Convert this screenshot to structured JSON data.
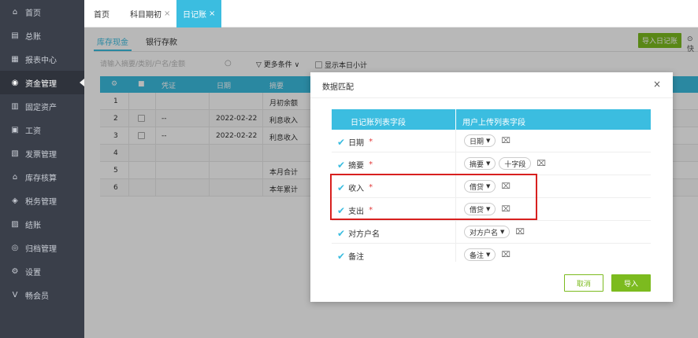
{
  "sidebar": {
    "items": [
      {
        "label": "首页",
        "icon": "home-icon",
        "glyph": "⌂"
      },
      {
        "label": "总账",
        "icon": "ledger-icon",
        "glyph": "▤"
      },
      {
        "label": "报表中心",
        "icon": "chart-icon",
        "glyph": "▦"
      },
      {
        "label": "资金管理",
        "icon": "fund-icon",
        "glyph": "◉"
      },
      {
        "label": "固定资产",
        "icon": "asset-icon",
        "glyph": "▥"
      },
      {
        "label": "工资",
        "icon": "salary-icon",
        "glyph": "▣"
      },
      {
        "label": "发票管理",
        "icon": "invoice-icon",
        "glyph": "▧"
      },
      {
        "label": "库存核算",
        "icon": "inventory-icon",
        "glyph": "⌂"
      },
      {
        "label": "税务管理",
        "icon": "tax-icon",
        "glyph": "◈"
      },
      {
        "label": "结账",
        "icon": "close-books-icon",
        "glyph": "▨"
      },
      {
        "label": "归档管理",
        "icon": "archive-icon",
        "glyph": "◎"
      },
      {
        "label": "设置",
        "icon": "settings-icon",
        "glyph": "⚙"
      },
      {
        "label": "畅会员",
        "icon": "vip-icon",
        "glyph": "V"
      }
    ],
    "active_index": 3
  },
  "tabs": [
    {
      "label": "首页",
      "closable": false
    },
    {
      "label": "科目期初",
      "closable": true
    },
    {
      "label": "日记账",
      "closable": true,
      "active": true
    }
  ],
  "subtabs": [
    {
      "label": "库存现金",
      "active": true
    },
    {
      "label": "银行存款",
      "active": false
    }
  ],
  "toolbar": {
    "import_label": "导入日记账",
    "gear_partial": "⊙ 快"
  },
  "filter": {
    "search_placeholder": "请输入摘要/类别/户名/金额",
    "more_conditions": "▽ 更多条件 ∨",
    "show_daily_subtotal": "显示本日小计"
  },
  "grid": {
    "headers": [
      "⚙",
      "■",
      "凭证",
      "日期",
      "摘要"
    ],
    "rows": [
      {
        "num": "1",
        "voucher": "",
        "date": "",
        "summary": "月初余额",
        "checkbox": false
      },
      {
        "num": "2",
        "voucher": "--",
        "date": "2022-02-22",
        "summary": "利息收入",
        "checkbox": true
      },
      {
        "num": "3",
        "voucher": "--",
        "date": "2022-02-22",
        "summary": "利息收入",
        "checkbox": true
      },
      {
        "num": "4",
        "voucher": "",
        "date": "",
        "summary": "",
        "checkbox": false
      },
      {
        "num": "5",
        "voucher": "",
        "date": "",
        "summary": "本月合计",
        "checkbox": false
      },
      {
        "num": "6",
        "voucher": "",
        "date": "",
        "summary": "本年累计",
        "checkbox": false
      }
    ]
  },
  "dialog": {
    "title": "数据匹配",
    "close_glyph": "×",
    "col_left": "日记账列表字段",
    "col_right": "用户上传列表字段",
    "rows": [
      {
        "field": "日期",
        "required": true,
        "selects": [
          "日期"
        ],
        "extra": ""
      },
      {
        "field": "摘要",
        "required": true,
        "selects": [
          "摘要"
        ],
        "extra": "十字段"
      },
      {
        "field": "收入",
        "required": true,
        "selects": [
          "借贷"
        ],
        "extra": ""
      },
      {
        "field": "支出",
        "required": true,
        "selects": [
          "借贷"
        ],
        "extra": ""
      },
      {
        "field": "对方户名",
        "required": false,
        "selects": [
          "对方户名"
        ],
        "extra": ""
      },
      {
        "field": "备注",
        "required": false,
        "selects": [
          "备注"
        ],
        "extra": ""
      }
    ],
    "required_mark": "*",
    "cancel_label": "取消",
    "import_label": "导入"
  }
}
